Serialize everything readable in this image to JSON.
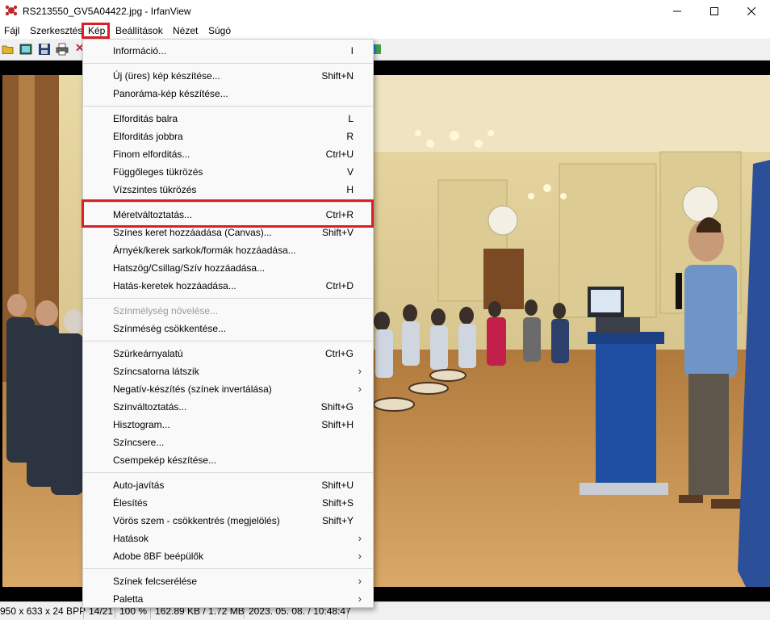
{
  "window": {
    "title": "RS213550_GV5A04422.jpg - IrfanView",
    "app_icon": "irfanview-cat-icon",
    "controls": [
      "minimize-icon",
      "maximize-icon",
      "close-icon"
    ]
  },
  "menubar": {
    "items": [
      "Fájl",
      "Szerkesztés",
      "Kép",
      "Beállítások",
      "Nézet",
      "Súgó"
    ],
    "active": "Kép"
  },
  "toolbar": {
    "icons": [
      "open-folder-icon",
      "thumbnails-icon",
      "save-icon",
      "print-icon"
    ]
  },
  "image_menu": {
    "items": [
      {
        "label": "Információ...",
        "shortcut": "I"
      },
      {
        "label": "Új (üres) kép készítése...",
        "shortcut": "Shift+N"
      },
      {
        "label": "Panoráma-kép készítése...",
        "shortcut": ""
      },
      {
        "label": "Elforditás balra",
        "shortcut": "L"
      },
      {
        "label": "Elforditás jobbra",
        "shortcut": "R"
      },
      {
        "label": "Finom elforditás...",
        "shortcut": "Ctrl+U"
      },
      {
        "label": "Függőleges tükrözés",
        "shortcut": "V"
      },
      {
        "label": "Vízszintes tükrözés",
        "shortcut": "H"
      },
      {
        "label": "Méretváltoztatás...",
        "shortcut": "Ctrl+R",
        "highlighted": true
      },
      {
        "label": "Színes keret hozzáadása (Canvas)...",
        "shortcut": "Shift+V"
      },
      {
        "label": "Árnyék/kerek sarkok/formák hozzáadása...",
        "shortcut": ""
      },
      {
        "label": "Hatszög/Csillag/Szív hozzáadása...",
        "shortcut": ""
      },
      {
        "label": "Hatás-keretek hozzáadása...",
        "shortcut": "Ctrl+D"
      },
      {
        "label": "Színmélység növelése...",
        "shortcut": "",
        "disabled": true
      },
      {
        "label": "Színméség csökkentése...",
        "shortcut": ""
      },
      {
        "label": "Szürkeárnyalatú",
        "shortcut": "Ctrl+G"
      },
      {
        "label": "Színcsatorna látszik",
        "shortcut": "",
        "submenu": true
      },
      {
        "label": "Negatív-készítés (színek invertálása)",
        "shortcut": "",
        "submenu": true
      },
      {
        "label": "Színváltoztatás...",
        "shortcut": "Shift+G"
      },
      {
        "label": "Hisztogram...",
        "shortcut": "Shift+H"
      },
      {
        "label": "Színcsere...",
        "shortcut": ""
      },
      {
        "label": "Csempekép készítése...",
        "shortcut": ""
      },
      {
        "label": "Auto-javítás",
        "shortcut": "Shift+U"
      },
      {
        "label": "Élesítés",
        "shortcut": "Shift+S"
      },
      {
        "label": "Vörös szem - csökkentrés (megjelölés)",
        "shortcut": "Shift+Y"
      },
      {
        "label": "Hatások",
        "shortcut": "",
        "submenu": true
      },
      {
        "label": "Adobe 8BF beépülők",
        "shortcut": "",
        "submenu": true
      },
      {
        "label": "Színek felcserélése",
        "shortcut": "",
        "submenu": true
      },
      {
        "label": "Paletta",
        "shortcut": "",
        "submenu": true
      }
    ],
    "submenu_arrow": "›"
  },
  "statusbar": {
    "dimensions": "950 x 633 x 24 BPP",
    "index": "14/21",
    "zoom": "100 %",
    "filesize": "162.89 KB / 1.72 MB",
    "datetime": "2023. 05. 08. / 10:48:47"
  },
  "colors": {
    "highlight_border": "#d91f26",
    "menu_bg": "#f9f9f9",
    "disabled_text": "#9a9a9a"
  }
}
